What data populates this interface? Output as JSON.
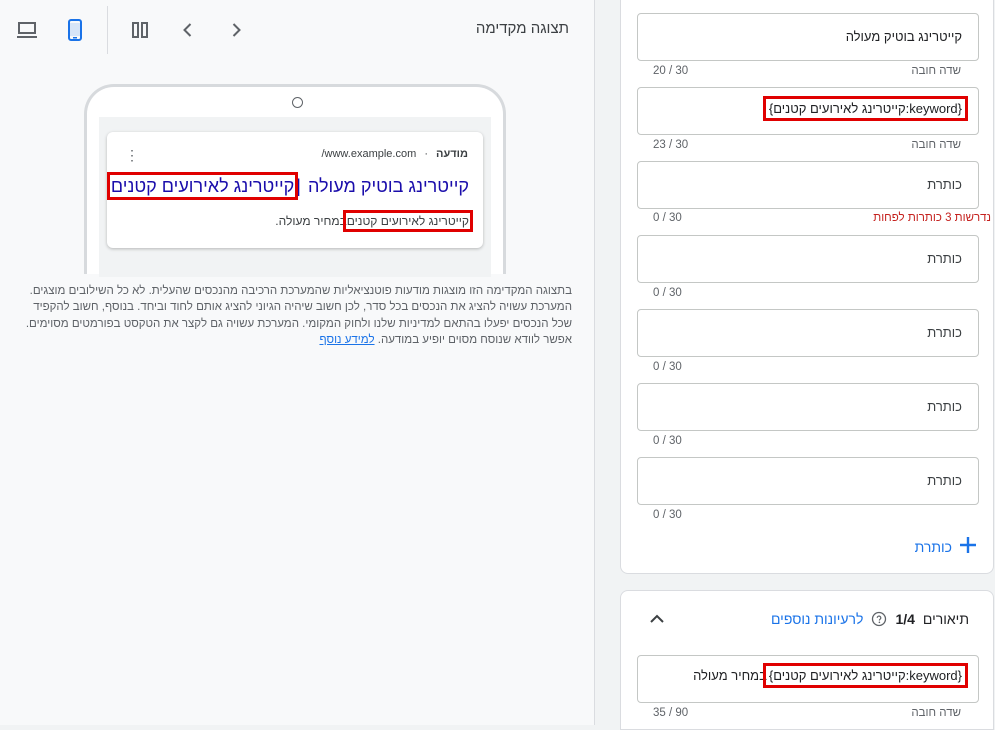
{
  "preview": {
    "title": "תצוגה מקדימה",
    "toolbar": {
      "desktop_icon": "laptop-icon",
      "mobile_icon": "smartphone-icon",
      "columns_icon": "columns-icon",
      "prev_icon": "chevron-left-icon",
      "next_icon": "chevron-right-icon"
    },
    "ad": {
      "label": "מודעה",
      "separator": "·",
      "url": "www.example.com/",
      "headline_part1": "קייטרינג בוטיק מעולה",
      "headline_separator": "|",
      "headline_part2": "קייטרינג לאירועים קטנים",
      "description_part1": "קייטרינג לאירועים קטנים",
      "description_part2": "במחיר מעולה."
    },
    "note": "בתצוגה המקדימה הזו מוצגות מודעות פוטנציאליות שהמערכת הרכיבה מהנכסים שהעלית. לא כל השילובים מוצגים. המערכת עשויה להציג את הנכסים בכל סדר, לכן חשוב שיהיה הגיוני להציג אותם לחוד וביחד. בנוסף, חשוב להקפיד שכל הנכסים יפעלו בהתאם למדיניות שלנו ולחוק המקומי. המערכת עשויה גם לקצר את הטקסט בפורמטים מסוימים. אפשר לוודא שנוסח מסוים יופיע במודעה.",
    "learn_more": "למידע נוסף"
  },
  "headlines": {
    "fields": [
      {
        "value": "קייטרינג בוטיק מעולה",
        "placeholder": "",
        "helper": "שדה חובה",
        "count": "20 / 30"
      },
      {
        "value": "{keyword:קייטרינג לאירועים קטנים}",
        "placeholder": "",
        "helper": "שדה חובה",
        "count": "23 / 30"
      },
      {
        "value": "",
        "placeholder": "כותרת",
        "helper": "נדרשות 3 כותרות לפחות",
        "count": "0 / 30"
      },
      {
        "value": "",
        "placeholder": "כותרת",
        "helper": "",
        "count": "0 / 30"
      },
      {
        "value": "",
        "placeholder": "כותרת",
        "helper": "",
        "count": "0 / 30"
      },
      {
        "value": "",
        "placeholder": "כותרת",
        "helper": "",
        "count": "0 / 30"
      },
      {
        "value": "",
        "placeholder": "כותרת",
        "helper": "",
        "count": "0 / 30"
      }
    ],
    "add_label": "כותרת"
  },
  "descriptions": {
    "title": "תיאורים",
    "count": "1/4",
    "ideas_link": "לרעיונות נוספים",
    "fields": [
      {
        "value_keyword": "{keyword:קייטרינג לאירועים קטנים}",
        "value_rest": "במחיר מעולה",
        "helper": "שדה חובה",
        "count": "35 / 90"
      }
    ]
  },
  "colors": {
    "accent": "#1a73e8",
    "highlight": "#e00000",
    "error": "#c5221f",
    "headline_link": "#1a0dab"
  }
}
